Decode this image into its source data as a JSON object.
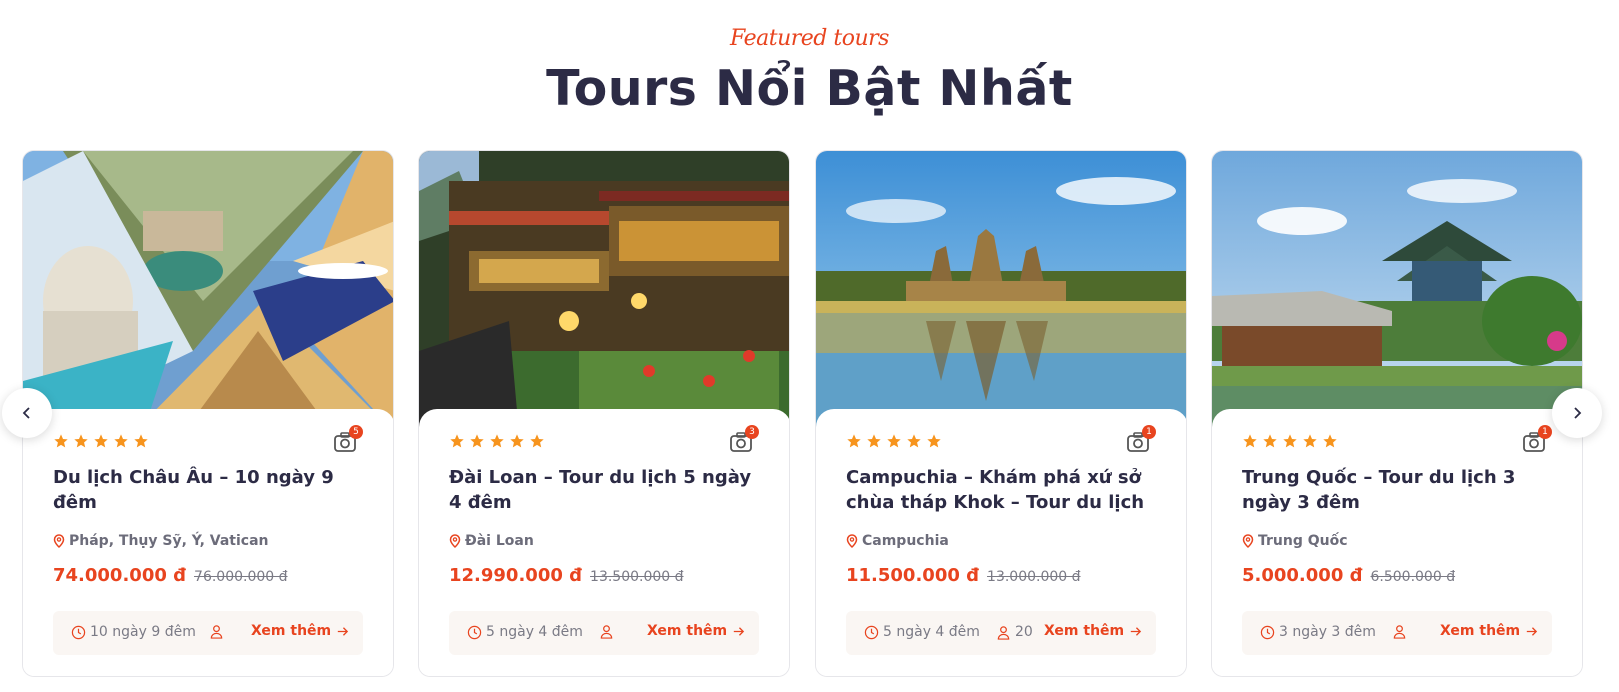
{
  "section": {
    "subtitle": "Featured tours",
    "title": "Tours Nổi Bật Nhất"
  },
  "colors": {
    "accent": "#e8441f",
    "title": "#2c2b45",
    "muted": "#7a7a85",
    "meta_bg": "#faf6f3",
    "star": "#f7941d"
  },
  "icons": {
    "prev": "chevron-left-icon",
    "next": "chevron-right-icon",
    "rating": "star-icon",
    "gallery": "camera-icon",
    "location": "map-pin-icon",
    "duration": "clock-icon",
    "people": "user-icon",
    "more": "arrow-right-icon"
  },
  "tours": [
    {
      "rating": 5,
      "photo_count": "5",
      "name": "Du lịch Châu Âu – 10 ngày 9 đêm",
      "location": "Pháp, Thụy Sỹ, Ý, Vatican",
      "price": "74.000.000 đ",
      "old_price": "76.000.000 đ",
      "duration": "10 ngày 9 đêm",
      "people": "",
      "more": "Xem thêm"
    },
    {
      "rating": 5,
      "photo_count": "3",
      "name": "Đài Loan – Tour du lịch 5 ngày 4 đêm",
      "location": "Đài Loan",
      "price": "12.990.000 đ",
      "old_price": "13.500.000 đ",
      "duration": "5 ngày 4 đêm",
      "people": "",
      "more": "Xem thêm"
    },
    {
      "rating": 5,
      "photo_count": "1",
      "name": "Campuchia – Khám phá xứ sở chùa tháp Khok – Tour du lịch ...",
      "location": "Campuchia",
      "price": "11.500.000 đ",
      "old_price": "13.000.000 đ",
      "duration": "5 ngày 4 đêm",
      "people": "20",
      "more": "Xem thêm"
    },
    {
      "rating": 5,
      "photo_count": "1",
      "name": "Trung Quốc – Tour du lịch 3 ngày 3 đêm",
      "location": "Trung Quốc",
      "price": "5.000.000 đ",
      "old_price": "6.500.000 đ",
      "duration": "3 ngày 3 đêm",
      "people": "",
      "more": "Xem thêm"
    }
  ]
}
